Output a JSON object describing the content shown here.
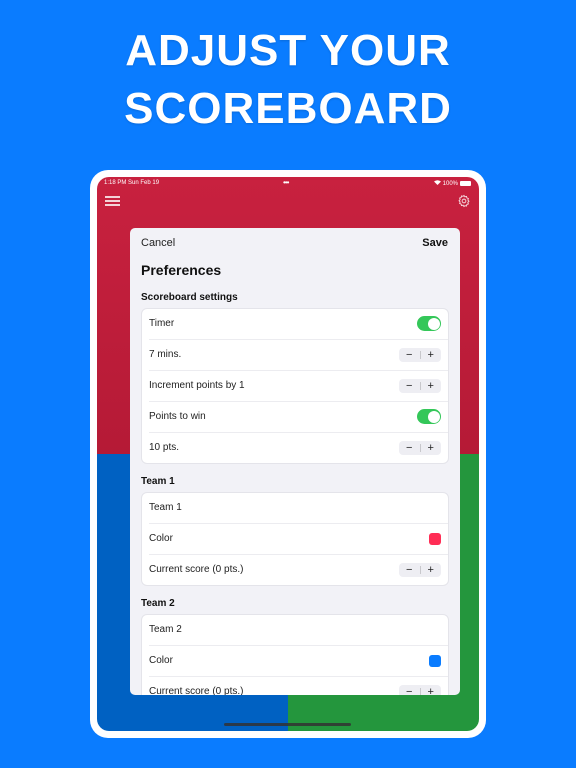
{
  "headline": {
    "line1": "ADJUST YOUR",
    "line2": "SCOREBOARD"
  },
  "statusbar": {
    "time": "1:18 PM  Sun Feb 19",
    "dots": "•••",
    "battery": "100%"
  },
  "sheet": {
    "cancel_label": "Cancel",
    "save_label": "Save",
    "title": "Preferences",
    "sections": {
      "scoreboard": {
        "header": "Scoreboard settings",
        "timer_label": "Timer",
        "timer_on": true,
        "minutes_label": "7 mins.",
        "increment_label": "Increment points by 1",
        "points_to_win_label": "Points to win",
        "points_to_win_on": true,
        "points_label": "10 pts."
      },
      "team1": {
        "header": "Team 1",
        "name": "Team 1",
        "color_label": "Color",
        "color": "#ff2d55",
        "score_label": "Current score (0 pts.)"
      },
      "team2": {
        "header": "Team 2",
        "name": "Team 2",
        "color_label": "Color",
        "color": "#0a7cff",
        "score_label": "Current score (0 pts.)"
      }
    }
  },
  "stepper": {
    "minus": "−",
    "plus": "+"
  },
  "colors": {
    "background": "#0a7cff",
    "team1": "#c8213f",
    "team2": "#0061c2",
    "team3": "#24963d",
    "toggle_on": "#34c759"
  }
}
